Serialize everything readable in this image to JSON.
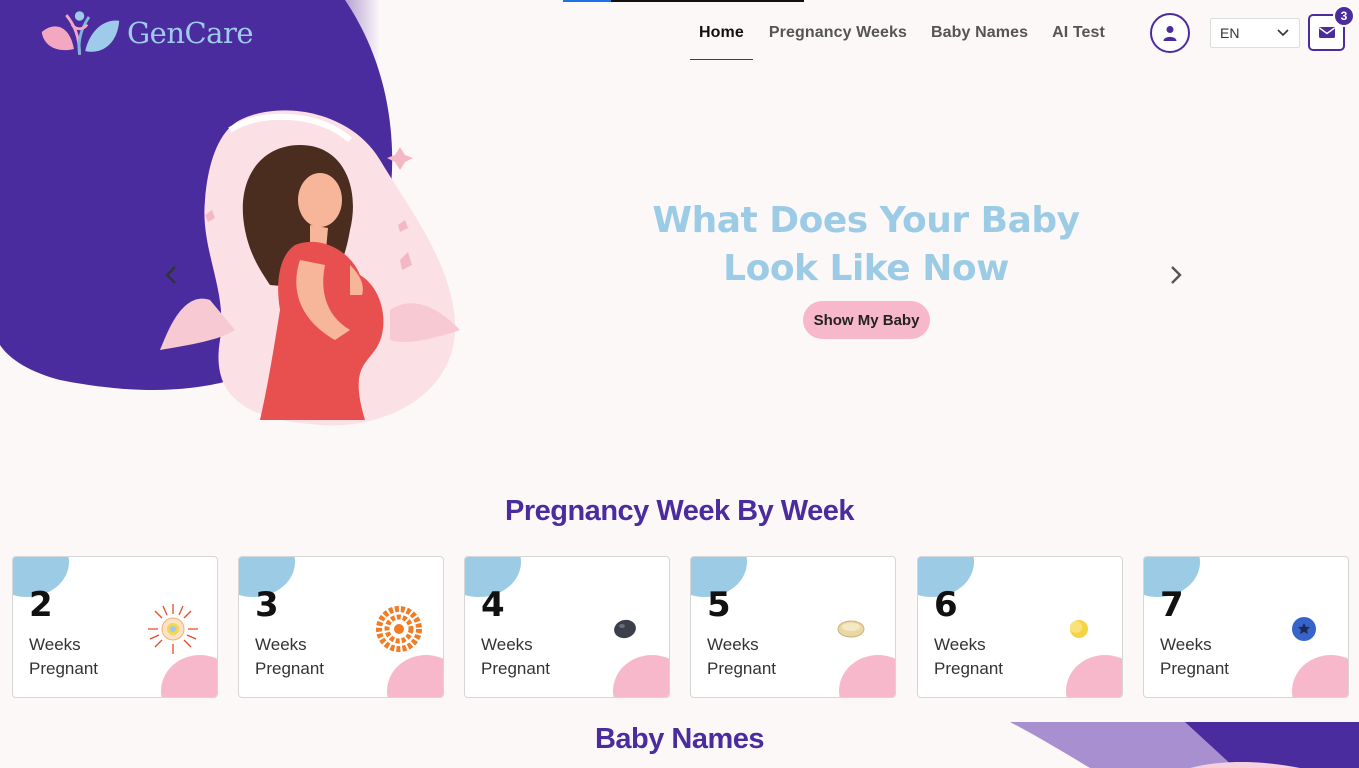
{
  "brand": {
    "name": "GenCare"
  },
  "nav": {
    "items": [
      {
        "label": "Home",
        "active": true
      },
      {
        "label": "Pregnancy Weeks",
        "active": false
      },
      {
        "label": "Baby Names",
        "active": false
      },
      {
        "label": "AI Test",
        "active": false
      }
    ],
    "user_icon": "user-icon",
    "language": {
      "selected": "EN",
      "icon": "chevron-down-icon"
    },
    "mail": {
      "icon": "envelope-icon",
      "badge_count": "3"
    }
  },
  "hero": {
    "title_line1": "What Does Your Baby",
    "title_line2": "Look Like Now",
    "button_label": "Show My Baby",
    "prev_icon": "chevron-left-icon",
    "next_icon": "chevron-right-icon"
  },
  "weeks_section": {
    "title": "Pregnancy Week By Week",
    "cards": [
      {
        "number": "2",
        "line1": "Weeks",
        "line2": "Pregnant",
        "icon": "ovum-icon"
      },
      {
        "number": "3",
        "line1": "Weeks",
        "line2": "Pregnant",
        "icon": "cell-cluster-icon"
      },
      {
        "number": "4",
        "line1": "Weeks",
        "line2": "Pregnant",
        "icon": "poppy-seed-icon"
      },
      {
        "number": "5",
        "line1": "Weeks",
        "line2": "Pregnant",
        "icon": "sesame-seed-icon"
      },
      {
        "number": "6",
        "line1": "Weeks",
        "line2": "Pregnant",
        "icon": "lentil-icon"
      },
      {
        "number": "7",
        "line1": "Weeks",
        "line2": "Pregnant",
        "icon": "blueberry-icon"
      }
    ]
  },
  "names_section": {
    "title": "Baby Names"
  },
  "colors": {
    "primary": "#4b2c9e",
    "light_blue": "#9ccbe6",
    "pink": "#f8b8cc",
    "background": "#fdf8f8"
  }
}
